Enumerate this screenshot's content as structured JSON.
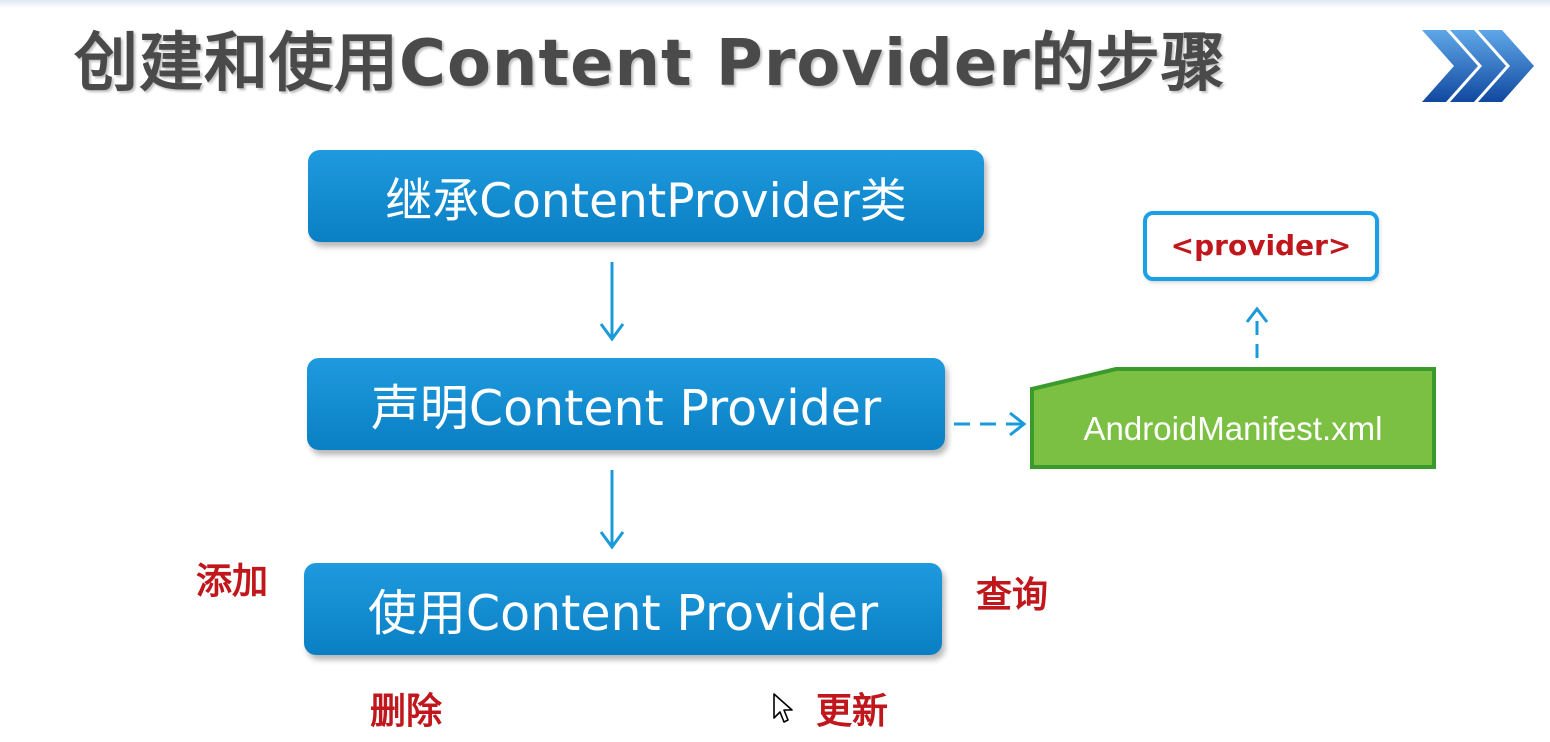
{
  "title": "创建和使用Content Provider的步骤",
  "steps": [
    {
      "label": "继承ContentProvider类"
    },
    {
      "label": "声明Content Provider"
    },
    {
      "label": "使用Content Provider"
    }
  ],
  "manifest": {
    "label": "AndroidManifest.xml",
    "tag": "<provider>"
  },
  "operations": {
    "add": "添加",
    "query": "查询",
    "delete": "删除",
    "update": "更新"
  },
  "colors": {
    "step_blue": "#0a7fc4",
    "manifest_green": "#6cb33f",
    "operation_red": "#c0171c",
    "title_gray": "#4a4a4a",
    "chevron_blue": "#1a5fb4"
  },
  "icons": {
    "title_decoration": "chevron-double-right-icon",
    "cursor": "mouse-pointer-icon"
  }
}
